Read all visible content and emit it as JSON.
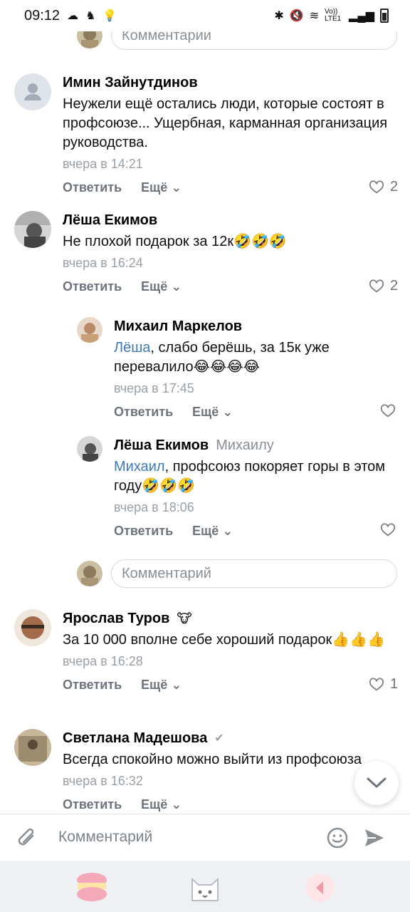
{
  "status_bar": {
    "time": "09:12",
    "network": "Vo)) LTE1"
  },
  "top_reply_placeholder": "Комментарии",
  "comments": [
    {
      "author": "Имин Зайнутдинов",
      "text": "Неужели ещё остались люди, которые состоят в профсоюзе... Ущербная, карманная организация руководства.",
      "time": "вчера в 14:21",
      "reply_label": "Ответить",
      "more_label": "Ещё",
      "likes": "2"
    },
    {
      "author": "Лёша Екимов",
      "text": "Не плохой подарок за 12к🤣🤣🤣",
      "time": "вчера в 16:24",
      "reply_label": "Ответить",
      "more_label": "Ещё",
      "likes": "2"
    },
    {
      "author": "Михаил Маркелов",
      "mention": "Лёша",
      "text": ", слабо берёшь, за 15к уже перевалило😂😂😂😂",
      "time": "вчера в 17:45",
      "reply_label": "Ответить",
      "more_label": "Ещё"
    },
    {
      "author": "Лёша Екимов",
      "reply_to": "Михаилу",
      "mention": "Михаил",
      "text": ", профсоюз покоряет горы в этом году🤣🤣🤣",
      "time": "вчера в 18:06",
      "reply_label": "Ответить",
      "more_label": "Ещё"
    },
    {
      "author": "Ярослав Туров",
      "text": "За 10 000 вполне себе хороший подарок👍👍👍",
      "time": "вчера в 16:28",
      "reply_label": "Ответить",
      "more_label": "Ещё",
      "likes": "1"
    },
    {
      "author": "Светлана Мадешова",
      "text": "Всегда спокойно можно выйти из профсоюза",
      "time": "вчера в 16:32",
      "reply_label": "Ответить",
      "more_label": "Ещё"
    }
  ],
  "thread_reply_placeholder": "Комментарий",
  "composer_placeholder": "Комментарий",
  "colors": {
    "accent": "#3f7ab8",
    "muted": "#8a8f96",
    "navbar_bg": "#eef0f4"
  }
}
